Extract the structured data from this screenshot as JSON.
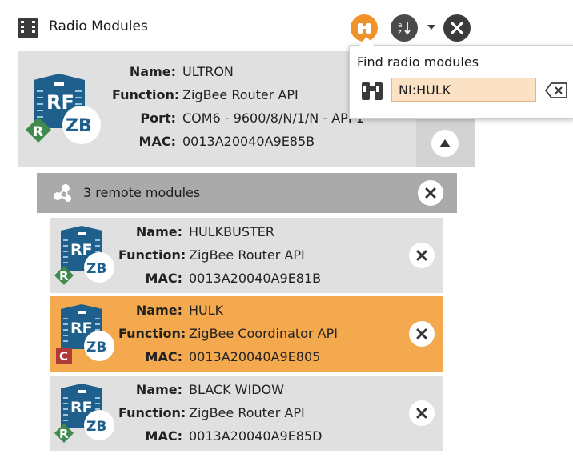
{
  "header": {
    "title": "Radio Modules",
    "icons": [
      "radio-module-list-icon",
      "find-radio-modules-icon",
      "sort-icon",
      "dropdown-caret-icon",
      "close-all-icon"
    ]
  },
  "local_module": {
    "labels": {
      "name": "Name:",
      "function": "Function:",
      "port": "Port:",
      "mac": "MAC:"
    },
    "name": "ULTRON",
    "function": "ZigBee Router API",
    "port": "COM6 - 9600/8/N/1/N - API 1",
    "mac": "0013A20040A9E85B",
    "role_badge": "R",
    "icon_letters": {
      "rf": "RF",
      "zb": "ZB"
    }
  },
  "remote": {
    "title": "3 remote modules",
    "modules": [
      {
        "name": "HULKBUSTER",
        "function": "ZigBee Router API",
        "mac": "0013A20040A9E81B",
        "role_badge": "R",
        "selected": false
      },
      {
        "name": "HULK",
        "function": "ZigBee Coordinator API",
        "mac": "0013A20040A9E805",
        "role_badge": "C",
        "selected": true
      },
      {
        "name": "BLACK WIDOW",
        "function": "ZigBee Router API",
        "mac": "0013A20040A9E85D",
        "role_badge": "R",
        "selected": false
      }
    ],
    "labels": {
      "name": "Name:",
      "function": "Function:",
      "mac": "MAC:"
    }
  },
  "find_popup": {
    "title": "Find radio modules",
    "query": "NI:HULK"
  },
  "colors": {
    "accent_orange": "#f0922a",
    "selected_card": "#f5a94e",
    "card_bg": "#e0e0e0",
    "remote_bar": "#aaaaaa",
    "rf_blue": "#1f5f8b",
    "router_green": "#3f8a4c",
    "coordinator_red": "#b03a3a"
  }
}
